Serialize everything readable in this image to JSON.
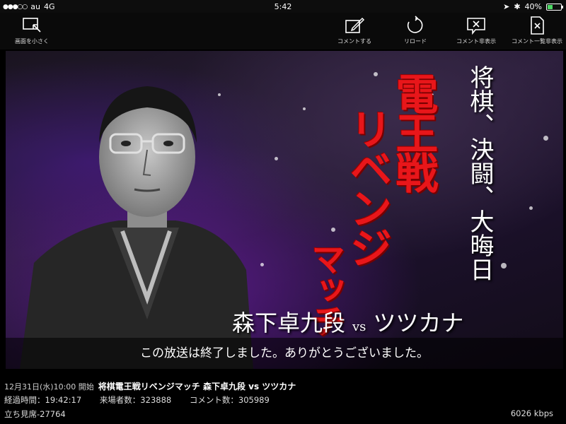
{
  "status": {
    "carrier": "au",
    "network": "4G",
    "time": "5:42",
    "battery": "40%",
    "battery_level": 0.4
  },
  "toolbar": {
    "shrink_label": "画面を小さく",
    "comment_label": "コメントする",
    "reload_label": "リロード",
    "hide_comments_label": "コメント非表示",
    "hide_comment_list_label": "コメント一覧非表示"
  },
  "video": {
    "title_chars_1": "電王戦",
    "title_chars_2": "リベンジ",
    "title_chars_3": "マッチ",
    "headline": "将棋、決闘、大晦日",
    "player1": "森下卓九段",
    "vs": "vs",
    "player2": "ツツカナ",
    "end_message": "この放送は終了しました。ありがとうございました。"
  },
  "info": {
    "start_time": "12月31日(水)10:00 開始",
    "program_title": "将棋電王戦リベンジマッチ 森下卓九段 vs ツツカナ",
    "elapsed": "経過時間：19:42:17",
    "visitors": "来場者数：323888",
    "comments": "コメント数：305989",
    "standing": "立ち見席-27764",
    "bitrate": "6026 kbps"
  }
}
